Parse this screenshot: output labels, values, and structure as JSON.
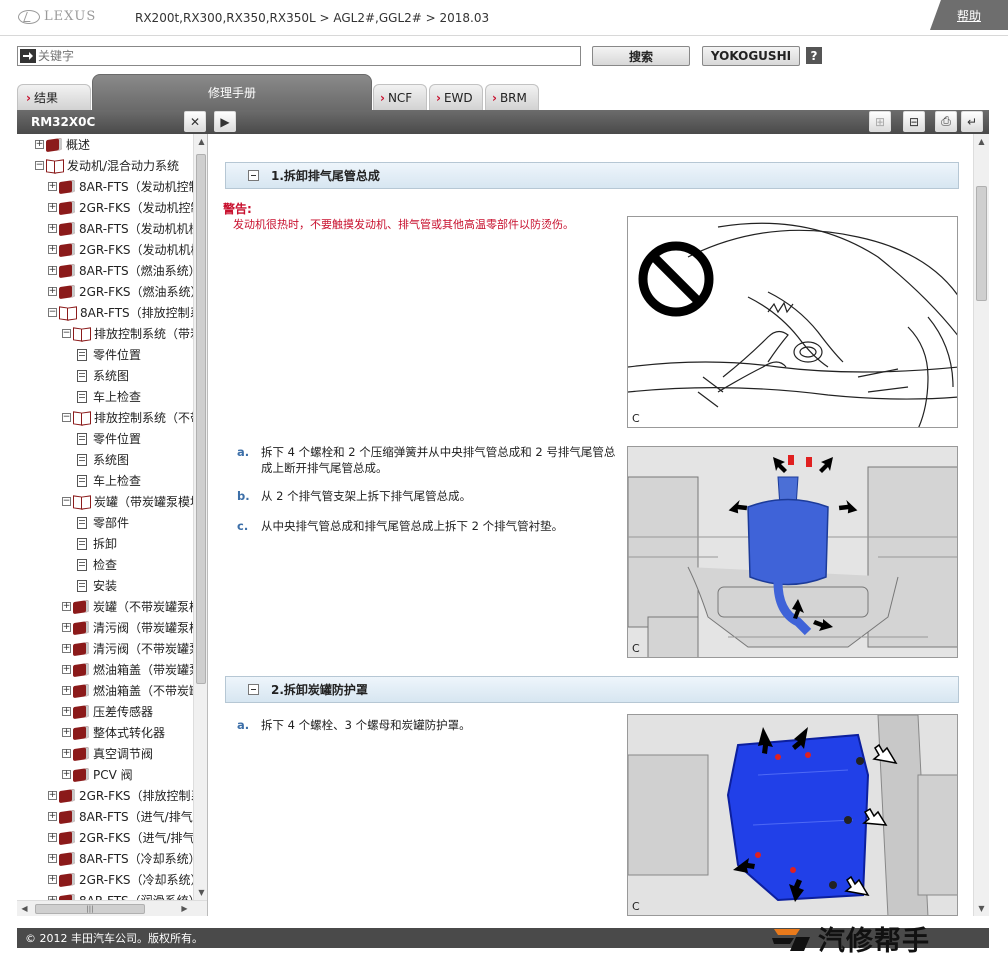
{
  "header": {
    "brand": "LEXUS",
    "breadcrumb": "RX200t,RX300,RX350,RX350L > AGL2#,GGL2# > 2018.03",
    "help": "帮助"
  },
  "search": {
    "placeholder": "关键字",
    "search_label": "搜索",
    "yokogushi_label": "YOKOGUSHI",
    "help_q": "?"
  },
  "tabs": {
    "results": "结果",
    "manual": "修理手册",
    "ncf": "NCF",
    "ewd": "EWD",
    "brm": "BRM"
  },
  "toolbar": {
    "doc_code": "RM32X0C",
    "close": "✕",
    "play": "▶",
    "expand": "⊞",
    "collapse": "⊟",
    "print": "⎙",
    "back": "↵"
  },
  "tree": [
    {
      "label": "概述",
      "indent": 1,
      "type": "book-closed",
      "toggle": "+"
    },
    {
      "label": "发动机/混合动力系统",
      "indent": 1,
      "type": "book-open",
      "toggle": "-"
    },
    {
      "label": "8AR-FTS（发动机控制",
      "indent": 2,
      "type": "book-closed",
      "toggle": "+"
    },
    {
      "label": "2GR-FKS（发动机控制",
      "indent": 2,
      "type": "book-closed",
      "toggle": "+"
    },
    {
      "label": "8AR-FTS（发动机机械",
      "indent": 2,
      "type": "book-closed",
      "toggle": "+"
    },
    {
      "label": "2GR-FKS（发动机机械",
      "indent": 2,
      "type": "book-closed",
      "toggle": "+"
    },
    {
      "label": "8AR-FTS（燃油系统）",
      "indent": 2,
      "type": "book-closed",
      "toggle": "+"
    },
    {
      "label": "2GR-FKS（燃油系统）",
      "indent": 2,
      "type": "book-closed",
      "toggle": "+"
    },
    {
      "label": "8AR-FTS（排放控制系",
      "indent": 2,
      "type": "book-open",
      "toggle": "-"
    },
    {
      "label": "排放控制系统（带炭",
      "indent": 3,
      "type": "book-open",
      "toggle": "-"
    },
    {
      "label": "零件位置",
      "indent": 4,
      "type": "page"
    },
    {
      "label": "系统图",
      "indent": 4,
      "type": "page"
    },
    {
      "label": "车上检查",
      "indent": 4,
      "type": "page"
    },
    {
      "label": "排放控制系统（不带",
      "indent": 3,
      "type": "book-open",
      "toggle": "-"
    },
    {
      "label": "零件位置",
      "indent": 4,
      "type": "page"
    },
    {
      "label": "系统图",
      "indent": 4,
      "type": "page"
    },
    {
      "label": "车上检查",
      "indent": 4,
      "type": "page"
    },
    {
      "label": "炭罐（带炭罐泵模块",
      "indent": 3,
      "type": "book-open",
      "toggle": "-"
    },
    {
      "label": "零部件",
      "indent": 4,
      "type": "page"
    },
    {
      "label": "拆卸",
      "indent": 4,
      "type": "page"
    },
    {
      "label": "检查",
      "indent": 4,
      "type": "page"
    },
    {
      "label": "安装",
      "indent": 4,
      "type": "page"
    },
    {
      "label": "炭罐（不带炭罐泵模",
      "indent": 3,
      "type": "book-closed",
      "toggle": "+"
    },
    {
      "label": "清污阀（带炭罐泵模",
      "indent": 3,
      "type": "book-closed",
      "toggle": "+"
    },
    {
      "label": "清污阀（不带炭罐泵",
      "indent": 3,
      "type": "book-closed",
      "toggle": "+"
    },
    {
      "label": "燃油箱盖（带炭罐泵",
      "indent": 3,
      "type": "book-closed",
      "toggle": "+"
    },
    {
      "label": "燃油箱盖（不带炭罐",
      "indent": 3,
      "type": "book-closed",
      "toggle": "+"
    },
    {
      "label": "压差传感器",
      "indent": 3,
      "type": "book-closed",
      "toggle": "+"
    },
    {
      "label": "整体式转化器",
      "indent": 3,
      "type": "book-closed",
      "toggle": "+"
    },
    {
      "label": "真空调节阀",
      "indent": 3,
      "type": "book-closed",
      "toggle": "+"
    },
    {
      "label": "PCV 阀",
      "indent": 3,
      "type": "book-closed",
      "toggle": "+"
    },
    {
      "label": "2GR-FKS（排放控制系",
      "indent": 2,
      "type": "book-closed",
      "toggle": "+"
    },
    {
      "label": "8AR-FTS（进气/排气",
      "indent": 2,
      "type": "book-closed",
      "toggle": "+"
    },
    {
      "label": "2GR-FKS（进气/排气",
      "indent": 2,
      "type": "book-closed",
      "toggle": "+"
    },
    {
      "label": "8AR-FTS（冷却系统）",
      "indent": 2,
      "type": "book-closed",
      "toggle": "+"
    },
    {
      "label": "2GR-FKS（冷却系统）",
      "indent": 2,
      "type": "book-closed",
      "toggle": "+"
    },
    {
      "label": "8AR-FTS（润滑系统）",
      "indent": 2,
      "type": "book-closed",
      "toggle": "+"
    }
  ],
  "content": {
    "section1_title": "1.拆卸排气尾管总成",
    "warning_title": "警告:",
    "warning_text": "发动机很热时，不要触摸发动机、排气管或其他高温零部件以防烫伤。",
    "figure_label": "C",
    "steps1": [
      {
        "letter": "a.",
        "text": "拆下 4 个螺栓和 2 个压缩弹簧并从中央排气管总成和 2 号排气尾管总成上断开排气尾管总成。"
      },
      {
        "letter": "b.",
        "text": "从 2 个排气管支架上拆下排气尾管总成。"
      },
      {
        "letter": "c.",
        "text": "从中央排气管总成和排气尾管总成上拆下 2 个排气管衬垫。"
      }
    ],
    "section2_title": "2.拆卸炭罐防护罩",
    "steps2": [
      {
        "letter": "a.",
        "text": "拆下 4 个螺栓、3 个螺母和炭罐防护罩。"
      }
    ]
  },
  "footer": {
    "copyright": "© 2012 丰田汽车公司。版权所有。"
  },
  "watermark": {
    "text": "汽修帮手"
  }
}
